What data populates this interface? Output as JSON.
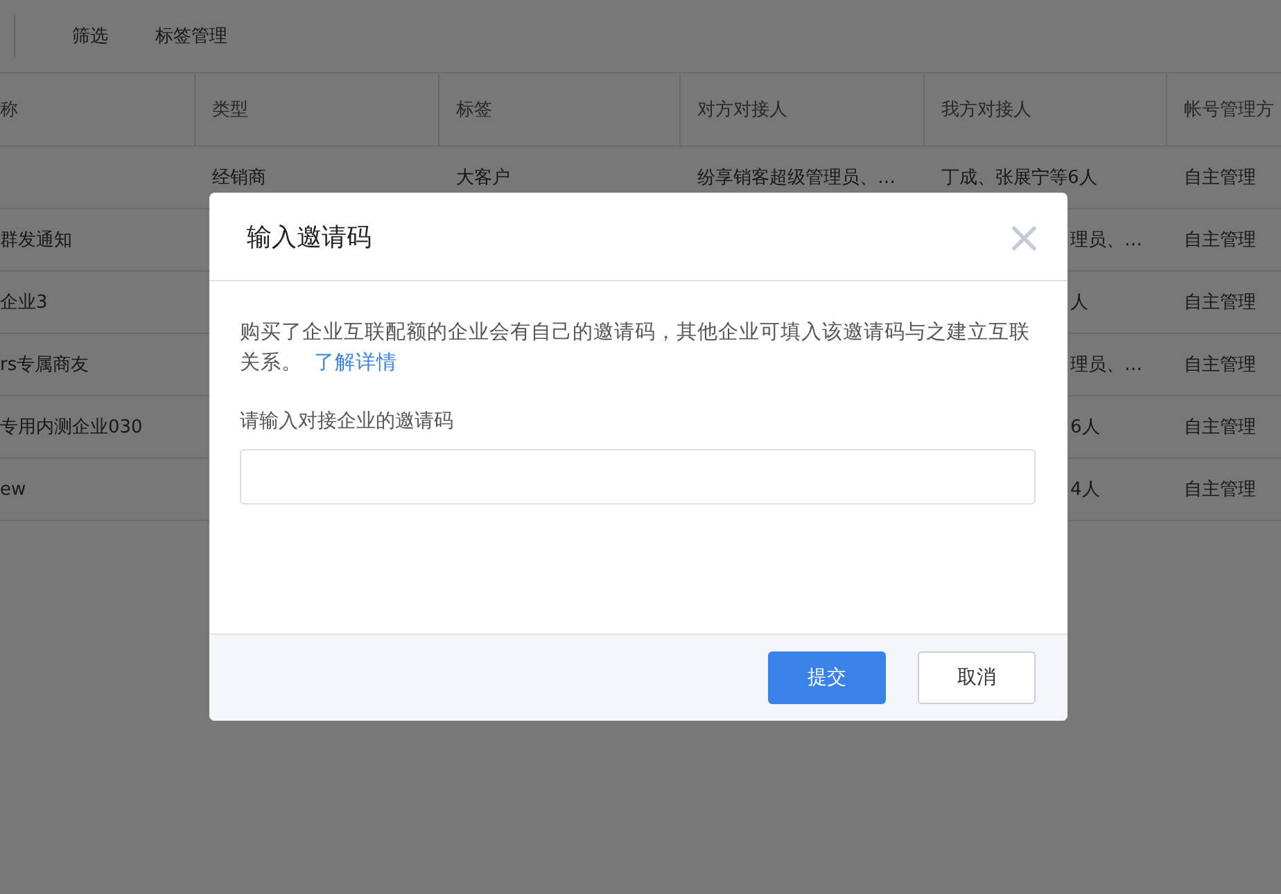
{
  "toolbar": {
    "items": [
      "筛选",
      "标签管理"
    ]
  },
  "table": {
    "columns": [
      "称",
      "类型",
      "标签",
      "对方对接人",
      "我方对接人",
      "帐号管理方"
    ],
    "rows": [
      {
        "kind": "full",
        "cells": [
          "",
          "经销商",
          "大客户",
          "纷享销客超级管理员、…",
          "丁成、张展宁等6人",
          "自主管理"
        ]
      },
      {
        "kind": "covered",
        "cells": [
          "群发通知",
          "理员、…",
          "自主管理"
        ]
      },
      {
        "kind": "covered",
        "cells": [
          "企业3",
          "人",
          "自主管理"
        ]
      },
      {
        "kind": "covered",
        "cells": [
          "rs专属商友",
          "理员、…",
          "自主管理"
        ]
      },
      {
        "kind": "covered",
        "cells": [
          "专用内测企业030",
          "6人",
          "自主管理"
        ]
      },
      {
        "kind": "covered",
        "cells": [
          "ew",
          "4人",
          "自主管理"
        ]
      }
    ]
  },
  "dialog": {
    "title": "输入邀请码",
    "close": "×",
    "description": "购买了企业互联配额的企业会有自己的邀请码，其他企业可填入该邀请码与之建立互联关系。",
    "link": "了解详情",
    "field_label": "请输入对接企业的邀请码",
    "buttons": [
      {
        "label": "提交",
        "kind": "primary"
      },
      {
        "label": "取消",
        "kind": "secondary"
      }
    ]
  }
}
